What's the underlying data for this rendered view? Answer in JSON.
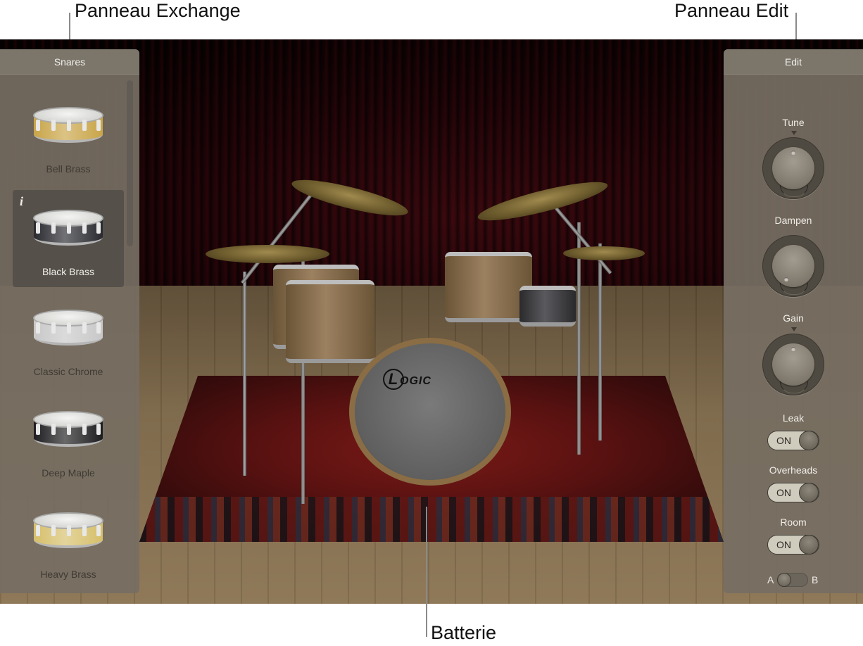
{
  "callouts": {
    "exchange": "Panneau Exchange",
    "edit": "Panneau Edit",
    "kit": "Batterie"
  },
  "exchange_panel": {
    "title": "Snares",
    "items": [
      {
        "label": "Bell Brass",
        "finish": "#c9a548",
        "selected": false
      },
      {
        "label": "Black Brass",
        "finish": "#2a2b30",
        "selected": true,
        "info_icon": "i"
      },
      {
        "label": "Classic Chrome",
        "finish": "#c8c8c8",
        "selected": false
      },
      {
        "label": "Deep Maple",
        "finish": "#1e1e20",
        "selected": false
      },
      {
        "label": "Heavy Brass",
        "finish": "#d6bf6a",
        "selected": false
      }
    ]
  },
  "stage": {
    "bass_drum_logo": "OGIC",
    "bass_drum_logo_initial": "L"
  },
  "edit_panel": {
    "title": "Edit",
    "knobs": [
      {
        "label": "Tune",
        "value_position": "center"
      },
      {
        "label": "Dampen",
        "value_position": "minimum"
      },
      {
        "label": "Gain",
        "value_position": "center"
      }
    ],
    "toggles": [
      {
        "label": "Leak",
        "state": "ON"
      },
      {
        "label": "Overheads",
        "state": "ON"
      },
      {
        "label": "Room",
        "state": "ON"
      }
    ],
    "ab_switch": {
      "left": "A",
      "right": "B",
      "selected": "A"
    }
  }
}
